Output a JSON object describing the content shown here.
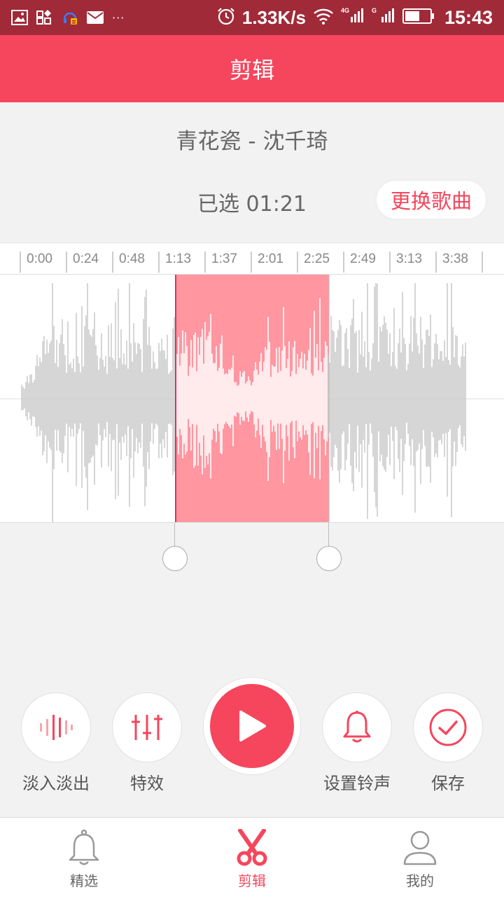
{
  "status_bar": {
    "net_speed": "1.33K/s",
    "time": "15:43",
    "more": "···",
    "signal_1": "4G",
    "signal_2": "G"
  },
  "header": {
    "title": "剪辑"
  },
  "song": {
    "title": "青花瓷 - 沈千琦",
    "selected_label": "已选 01:21",
    "change_button": "更换歌曲"
  },
  "timeline": {
    "ticks": [
      "0:00",
      "0:24",
      "0:48",
      "1:13",
      "1:37",
      "2:01",
      "2:25",
      "2:49",
      "3:13",
      "3:38"
    ]
  },
  "selection": {
    "start": "1:13",
    "end": "2:34"
  },
  "actions": {
    "fade_label": "淡入淡出",
    "effects_label": "特效",
    "ringtone_label": "设置铃声",
    "save_label": "保存"
  },
  "bottom_nav": {
    "items": [
      {
        "label": "精选",
        "icon": "bell-icon",
        "active": false
      },
      {
        "label": "剪辑",
        "icon": "scissors-icon",
        "active": true
      },
      {
        "label": "我的",
        "icon": "user-icon",
        "active": false
      }
    ]
  },
  "colors": {
    "accent": "#f5465d",
    "status_bar": "#a12a38",
    "selection": "#ff96a0",
    "wave": "#cccccc"
  }
}
